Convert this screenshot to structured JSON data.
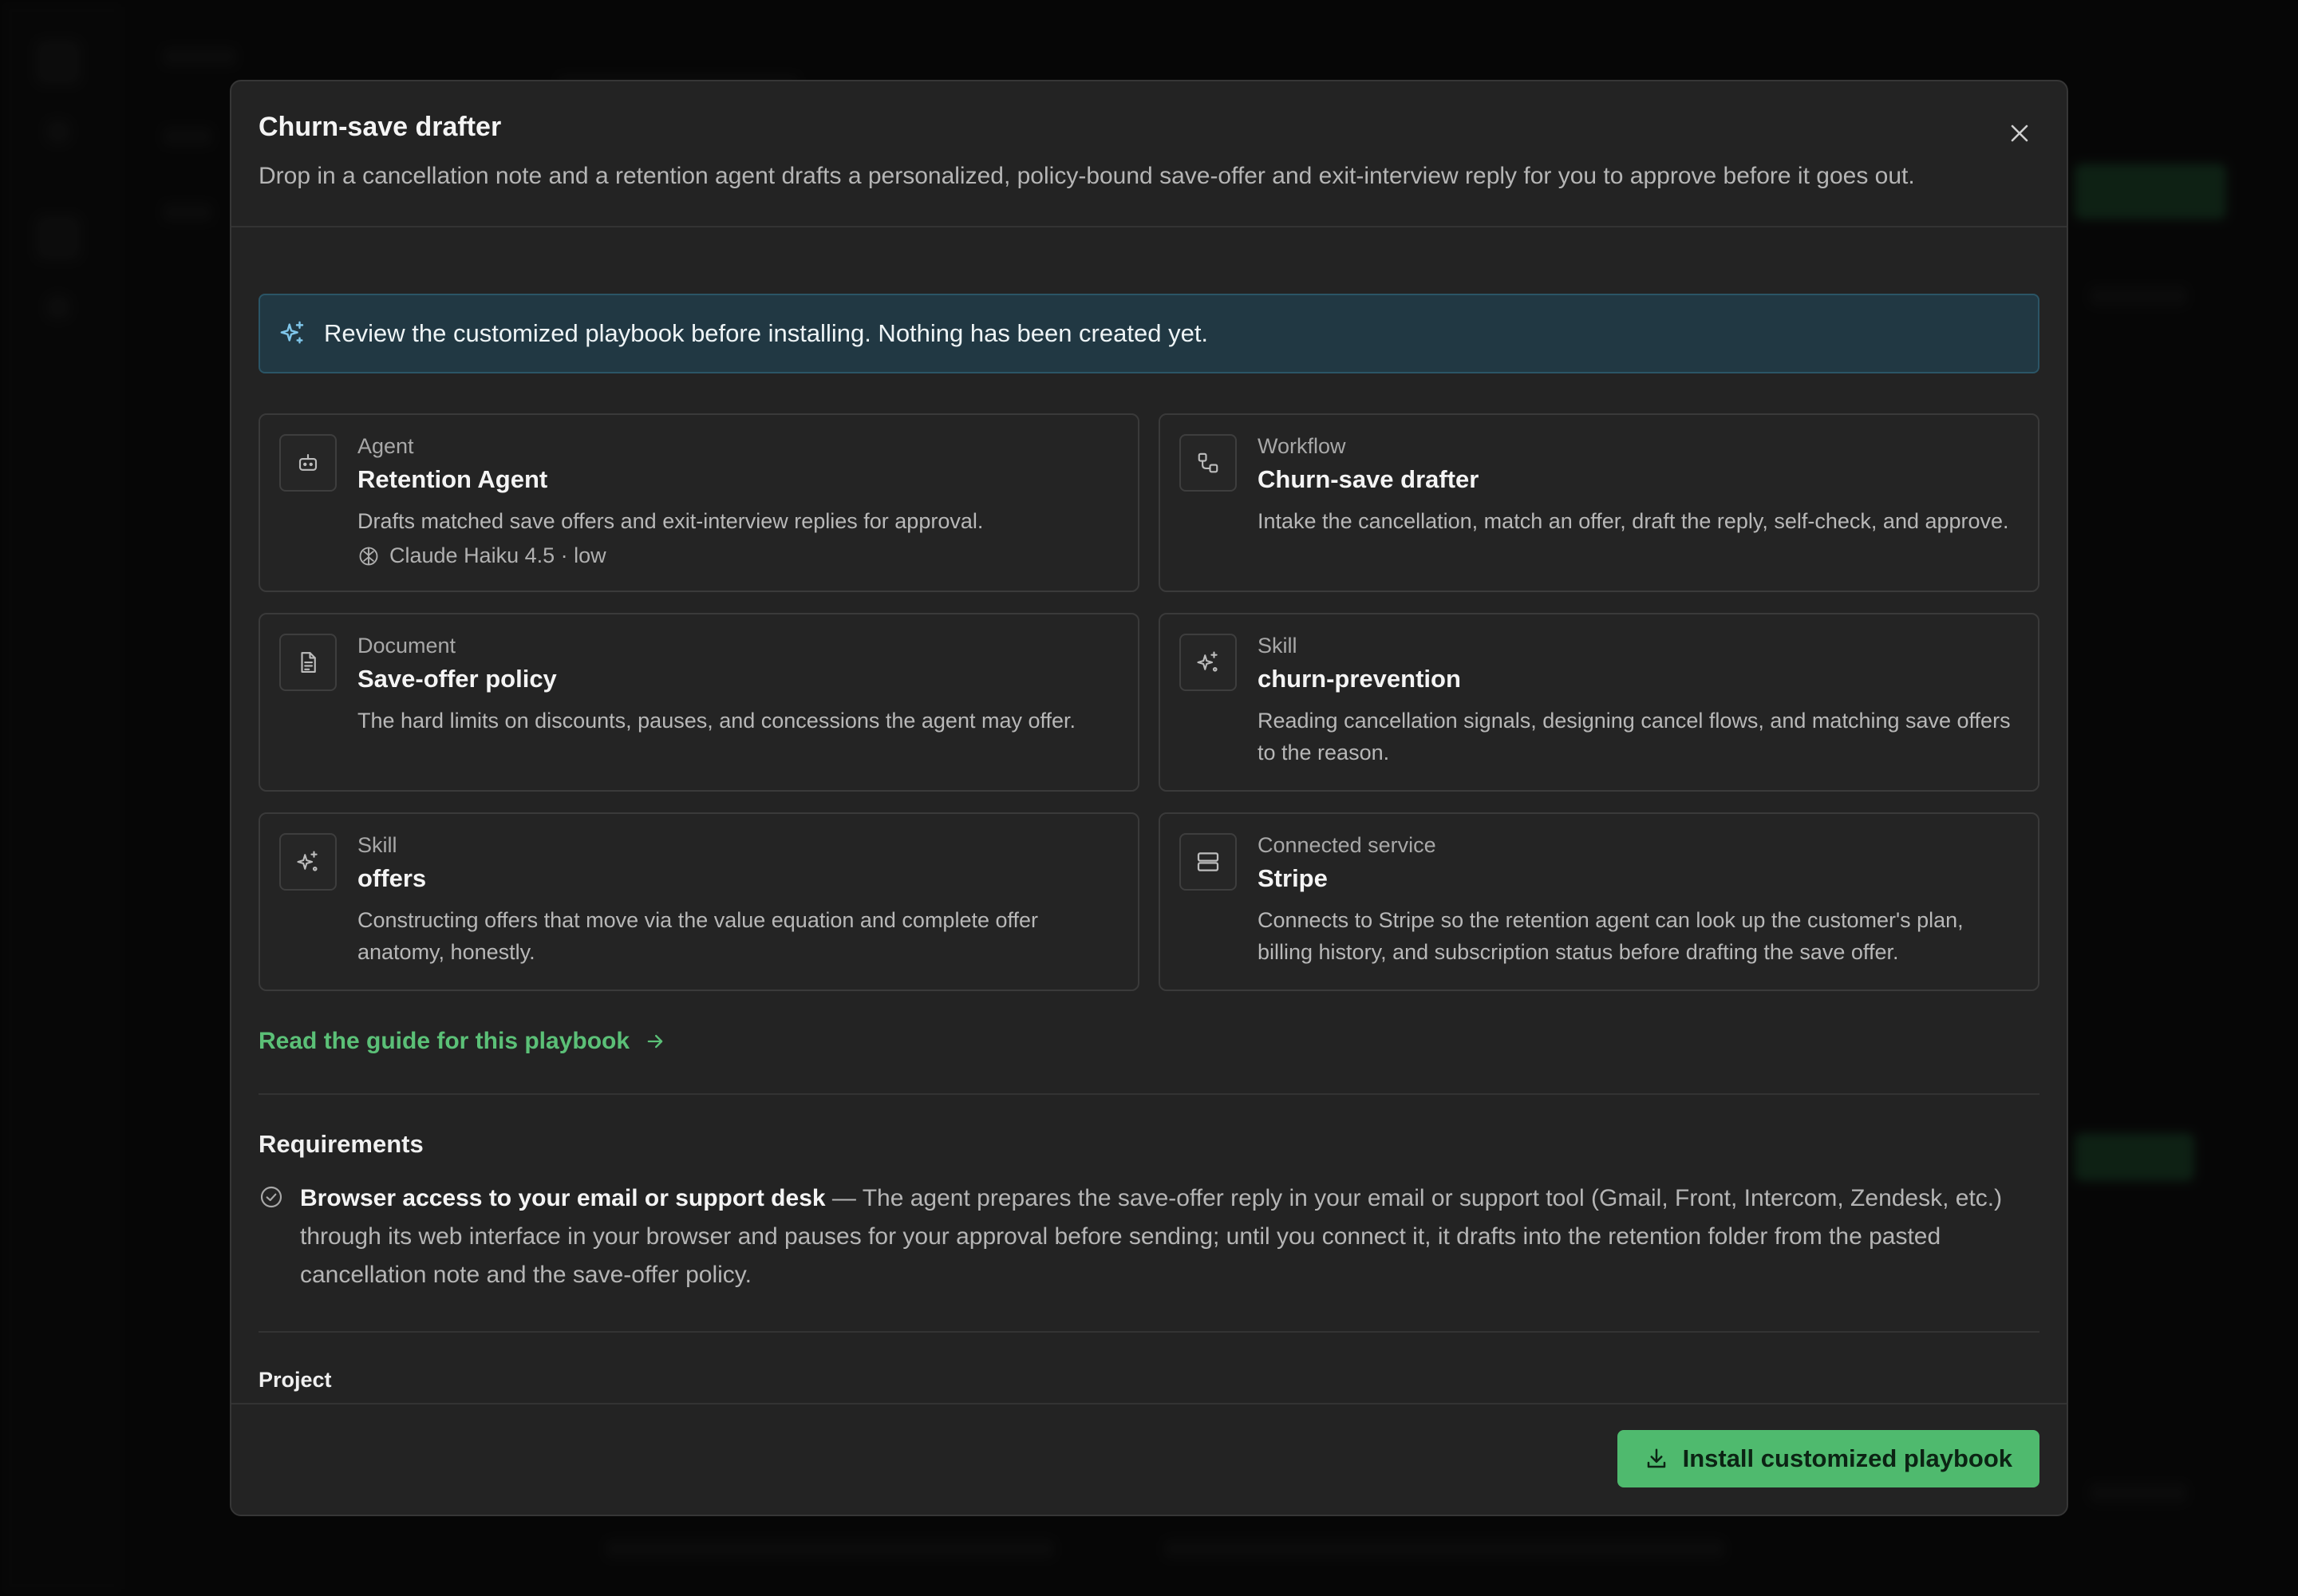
{
  "modal": {
    "title": "Churn-save drafter",
    "description": "Drop in a cancellation note and a retention agent drafts a personalized, policy-bound save-offer and exit-interview reply for you to approve before it goes out."
  },
  "notice": {
    "text": "Review the customized playbook before installing. Nothing has been created yet."
  },
  "components": [
    {
      "kind": "Agent",
      "name": "Retention Agent",
      "description": "Drafts matched save offers and exit-interview replies for approval.",
      "meta": "Claude Haiku 4.5 · low",
      "icon": "robot-icon"
    },
    {
      "kind": "Workflow",
      "name": "Churn-save drafter",
      "description": "Intake the cancellation, match an offer, draft the reply, self-check, and approve.",
      "icon": "workflow-icon"
    },
    {
      "kind": "Document",
      "name": "Save-offer policy",
      "description": "The hard limits on discounts, pauses, and concessions the agent may offer.",
      "icon": "document-icon"
    },
    {
      "kind": "Skill",
      "name": "churn-prevention",
      "description": "Reading cancellation signals, designing cancel flows, and matching save offers to the reason.",
      "icon": "sparkle-icon"
    },
    {
      "kind": "Skill",
      "name": "offers",
      "description": "Constructing offers that move via the value equation and complete offer anatomy, honestly.",
      "icon": "sparkle-icon"
    },
    {
      "kind": "Connected service",
      "name": "Stripe",
      "description": "Connects to Stripe so the retention agent can look up the customer's plan, billing history, and subscription status before drafting the save offer.",
      "icon": "server-icon"
    }
  ],
  "guide_link": "Read the guide for this playbook",
  "requirements": {
    "title": "Requirements",
    "items": [
      {
        "name": "Browser access to your email or support desk",
        "separator": " — ",
        "detail": "The agent prepares the save-offer reply in your email or support tool (Gmail, Front, Intercom, Zendesk, etc.) through its web interface in your browser and pauses for your approval before sending; until you connect it, it drafts into the retention folder from the pasted cancellation note and the save-offer policy."
      }
    ]
  },
  "project_label": "Project",
  "install_button": "Install customized playbook",
  "colors": {
    "accent": "#4fba6e",
    "notice_bg": "#213843",
    "link": "#5bc077"
  }
}
